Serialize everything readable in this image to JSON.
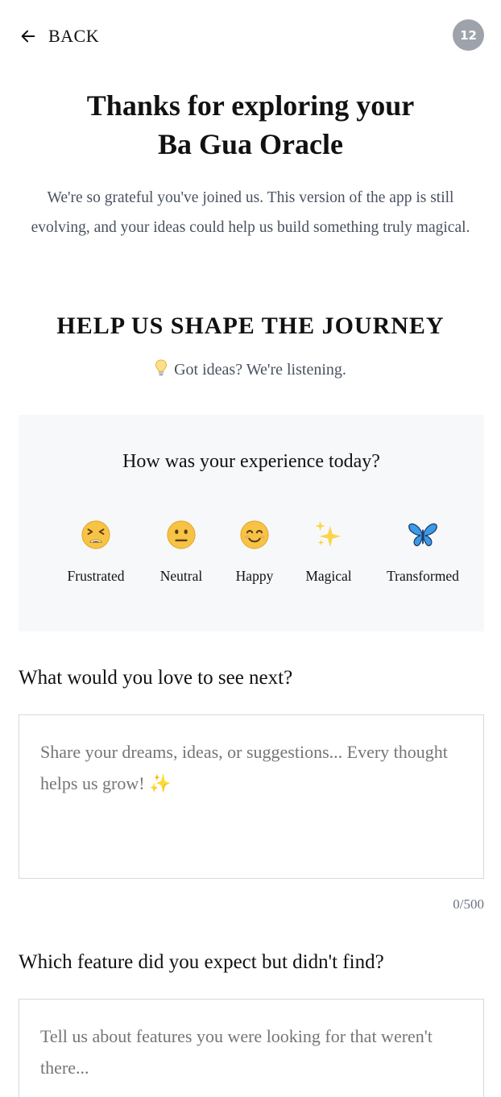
{
  "header": {
    "back_label": "BACK",
    "badge_count": "12"
  },
  "hero": {
    "title_line1": "Thanks for exploring your",
    "title_line2": "Ba Gua Oracle",
    "intro": "We're so grateful you've joined us. This version of the app is still evolving, and your ideas could help us build something truly magical."
  },
  "section": {
    "heading": "HELP US SHAPE THE JOURNEY",
    "sub_icon": "lightbulb-icon",
    "subheading": "Got ideas? We're listening."
  },
  "experience": {
    "question": "How was your experience today?",
    "moods": [
      {
        "label": "Frustrated",
        "icon": "frustrated-face-icon"
      },
      {
        "label": "Neutral",
        "icon": "neutral-face-icon"
      },
      {
        "label": "Happy",
        "icon": "smiling-face-icon"
      },
      {
        "label": "Magical",
        "icon": "sparkles-icon"
      },
      {
        "label": "Transformed",
        "icon": "butterfly-icon"
      }
    ]
  },
  "next_feedback": {
    "label": "What would you love to see next?",
    "placeholder": "Share your dreams, ideas, or suggestions... Every thought helps us grow! ✨",
    "counter": "0/500"
  },
  "missing_feature": {
    "label": "Which feature did you expect but didn't find?",
    "placeholder": "Tell us about features you were looking for that weren't there..."
  },
  "colors": {
    "badge": "#9ea3ab",
    "card_bg": "#f7f8fa",
    "muted_text": "#4a5260",
    "placeholder": "#a8adb5",
    "emoji_yellow": "#f6c344",
    "butterfly_blue": "#3b9be8"
  }
}
